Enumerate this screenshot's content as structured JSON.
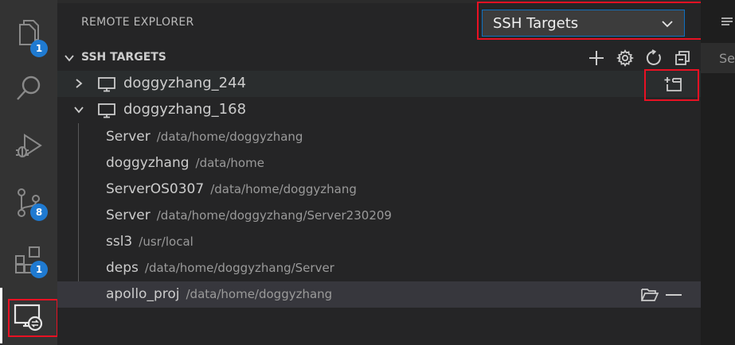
{
  "activity_bar": {
    "items": [
      {
        "name": "explorer",
        "icon": "files-icon",
        "badge": "1"
      },
      {
        "name": "search",
        "icon": "search-icon",
        "badge": ""
      },
      {
        "name": "run-debug",
        "icon": "debug-icon",
        "badge": ""
      },
      {
        "name": "source-control",
        "icon": "source-control-icon",
        "badge": "8"
      },
      {
        "name": "extensions",
        "icon": "extensions-icon",
        "badge": "1"
      },
      {
        "name": "remote-explorer",
        "icon": "remote-explorer-icon",
        "badge": "",
        "active": true
      }
    ]
  },
  "sidebar": {
    "title": "REMOTE EXPLORER",
    "dropdown": {
      "selected": "SSH Targets"
    },
    "section": {
      "title": "SSH TARGETS",
      "actions": [
        "add-icon",
        "gear-icon",
        "refresh-icon",
        "collapse-all-icon"
      ]
    },
    "hosts": [
      {
        "label": "doggyzhang_244",
        "expanded": false
      },
      {
        "label": "doggyzhang_168",
        "expanded": true
      }
    ],
    "folders": [
      {
        "name": "Server",
        "path": "/data/home/doggyzhang"
      },
      {
        "name": "doggyzhang",
        "path": "/data/home"
      },
      {
        "name": "ServerOS0307",
        "path": "/data/home/doggyzhang"
      },
      {
        "name": "Server",
        "path": "/data/home/doggyzhang/Server230209"
      },
      {
        "name": "ssl3",
        "path": "/usr/local"
      },
      {
        "name": "deps",
        "path": "/data/home/doggyzhang/Server"
      },
      {
        "name": "apollo_proj",
        "path": "/data/home/doggyzhang"
      }
    ]
  },
  "right_panel": {
    "tab_text": "Se"
  },
  "colors": {
    "activity_bg": "#333333",
    "sidebar_bg": "#252526",
    "badge": "#1f7ad1",
    "highlight_border": "#e81123",
    "dropdown_border": "#0e70c0"
  }
}
